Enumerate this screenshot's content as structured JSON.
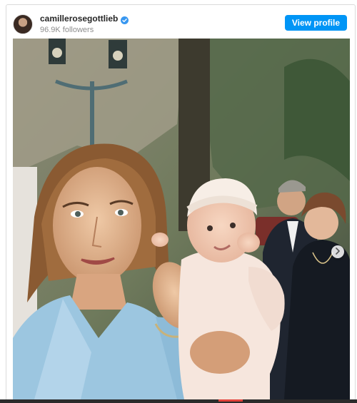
{
  "post": {
    "username": "camillerosegottlieb",
    "followers": "96.9K followers",
    "view_profile_label": "View profile",
    "verified": true,
    "image_alt": "Vintage photo of a woman in a light blue jacket holding a baby in a white headband, with people in the background"
  },
  "icons": {
    "verified": "verified-badge-icon",
    "next": "chevron-right-icon"
  },
  "colors": {
    "accent": "#0095f6",
    "text": "#262626",
    "muted": "#8e8e8e",
    "border": "#dbdbdb"
  }
}
